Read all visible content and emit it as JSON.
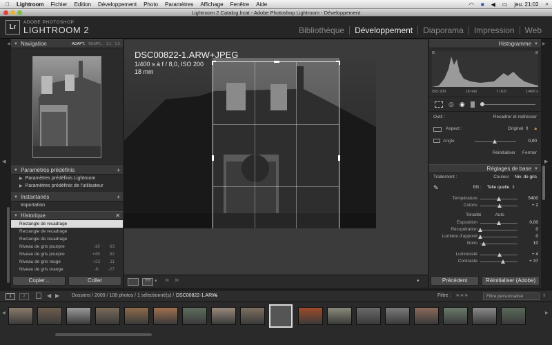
{
  "menubar": {
    "apple": "",
    "app": "Lightroom",
    "items": [
      "Fichier",
      "Edition",
      "Développement",
      "Photo",
      "Paramètres",
      "Affichage",
      "Fenêtre",
      "Aide"
    ],
    "clock": "jeu. 21:02"
  },
  "window": {
    "title": "Lightroom 2 Catalog.lrcat - Adobe Photoshop Lightroom - Développement"
  },
  "brand": {
    "logo": "Lr",
    "line1": "ADOBE PHOTOSHOP",
    "line2": "LIGHTROOM 2"
  },
  "modules": [
    "Bibliothèque",
    "Développement",
    "Diaporama",
    "Impression",
    "Web"
  ],
  "left": {
    "navigator": {
      "title": "Navigation",
      "zoom": [
        "ADAPT.",
        "REMPL.",
        "1:1",
        "1:2"
      ]
    },
    "presets": {
      "title": "Paramètres prédéfinis",
      "items": [
        "Paramètres prédéfinis Lightroom",
        "Paramètres prédéfinis de l'utilisateur"
      ]
    },
    "snapshots": {
      "title": "Instantanés",
      "items": [
        "Importation"
      ]
    },
    "history": {
      "title": "Historique",
      "items": [
        {
          "label": "Rectangle de recadrage",
          "a": "",
          "b": ""
        },
        {
          "label": "Rectangle de recadrage",
          "a": "",
          "b": ""
        },
        {
          "label": "Rectangle de recadrage",
          "a": "",
          "b": ""
        },
        {
          "label": "Niveau de gris pourpre",
          "a": "-19",
          "b": "63"
        },
        {
          "label": "Niveau de gris pourpre",
          "a": "+45",
          "b": "82"
        },
        {
          "label": "Niveau de gris rouge",
          "a": "+22",
          "b": "11"
        },
        {
          "label": "Niveau de gris orange",
          "a": "-6",
          "b": "-27"
        }
      ]
    },
    "copy_btn": "Copier...",
    "paste_btn": "Coller"
  },
  "photo": {
    "filename": "DSC00822-1.ARW+JPEG",
    "exif1": "1/400 s à f / 8,0, ISO 200",
    "exif2": "18 mm"
  },
  "right": {
    "histogram": {
      "title": "Histogramme",
      "iso": "ISO 200",
      "focal": "18 mm",
      "aperture": "f / 8,0",
      "shutter": "1/400 s"
    },
    "crop": {
      "tool_label": "Outil :",
      "tool_value": "Recadrer et redresser",
      "aspect_label": "Aspect :",
      "aspect_value": "Original",
      "angle_label": "Angle",
      "angle_value": "0,00",
      "reset": "Réinitialiser",
      "close": "Fermer"
    },
    "basic": {
      "title": "Réglages de base",
      "treatment_label": "Traitement :",
      "color": "Couleur",
      "gray": "Niv. de gris",
      "wb_label": "BB :",
      "wb_value": "Telle quelle",
      "sliders": [
        {
          "label": "Température",
          "value": "5400",
          "pos": 0.5
        },
        {
          "label": "Coloris",
          "value": "+ 2",
          "pos": 0.52
        }
      ],
      "tone_label": "Tonalité",
      "auto": "Auto",
      "tone": [
        {
          "label": "Exposition",
          "value": "0,00",
          "pos": 0.5
        },
        {
          "label": "Récupération",
          "value": "0",
          "pos": 0.0
        },
        {
          "label": "Lumière d'appoint",
          "value": "0",
          "pos": 0.0
        },
        {
          "label": "Noirs",
          "value": "10",
          "pos": 0.1
        }
      ],
      "presence": [
        {
          "label": "Luminosité",
          "value": "+ 4",
          "pos": 0.52
        },
        {
          "label": "Contraste",
          "value": "+ 37",
          "pos": 0.62
        }
      ]
    },
    "prev_btn": "Précédent",
    "reset_btn": "Réinitialiser (Adobe)"
  },
  "filmstrip": {
    "pages": [
      "1",
      "2"
    ],
    "path": "Dossiers / 2009 / 108 photos / 1 sélectionné(s) /",
    "file": "DSC00822-1.ARW",
    "filter_label": "Filtre :",
    "filter_value": "Filtre personnalisé"
  },
  "colors": {
    "accent": "#dcdcdc",
    "panel": "#2b2b2b",
    "bg": "#1e1e1e"
  }
}
